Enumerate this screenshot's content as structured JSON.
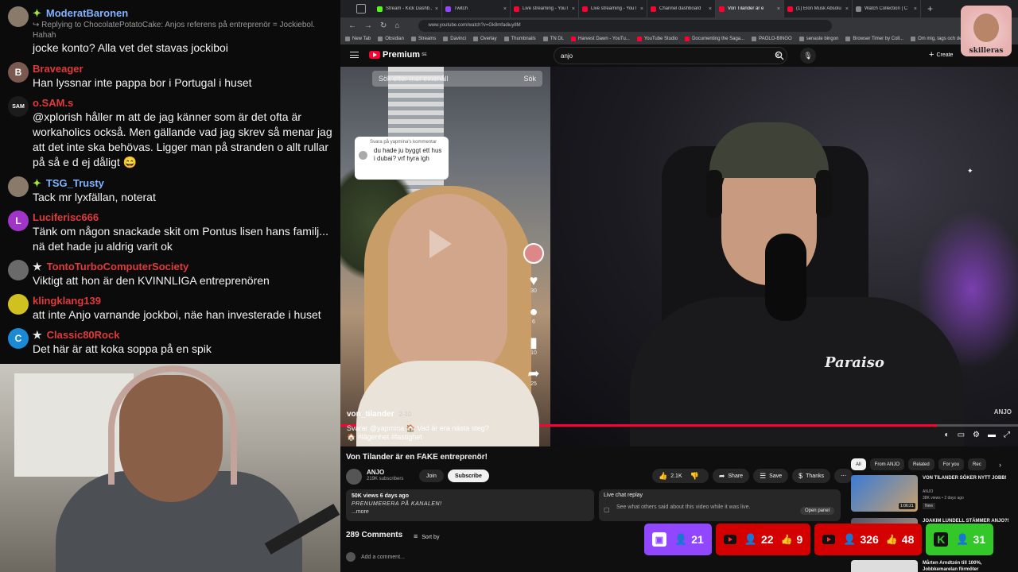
{
  "chat": {
    "messages": [
      {
        "user": "ModeratBaronen",
        "badge": "✦",
        "name_color": "#7fb2ff",
        "avatar_color": "#8a7a6a",
        "avatar_letter": "",
        "reply": "↪ Replying to ChocolatePotatoCake: Anjos referens på entreprenör = Jockiebol. Hahah",
        "text": "jocke konto? Alla vet det stavas jockiboi"
      },
      {
        "user": "Braveager",
        "badge": "",
        "name_color": "#e03a3a",
        "avatar_color": "#7a5a50",
        "avatar_letter": "B",
        "reply": "",
        "text": "Han lyssnar inte pappa bor i Portugal i huset"
      },
      {
        "user": "o.SAM.s",
        "badge": "",
        "name_color": "#e03a3a",
        "avatar_color": "#1c1c1c",
        "avatar_letter": "SAM",
        "reply": "",
        "text": "@xplorish håller m att de jag känner som är det ofta är workaholics också. Men gällande vad jag skrev så menar jag att det inte ska behövas. Ligger man på stranden o allt rullar på så e d ej dåligt 😄"
      },
      {
        "user": "TSG_Trusty",
        "badge": "✦",
        "name_color": "#7fb2ff",
        "avatar_color": "#8a7a6a",
        "avatar_letter": "",
        "reply": "",
        "text": "Tack mr lyxfällan, noterat"
      },
      {
        "user": "Luciferisc666",
        "badge": "",
        "name_color": "#e03a3a",
        "avatar_color": "#a035c8",
        "avatar_letter": "L",
        "reply": "",
        "text": "Tänk om någon snackade skit om Pontus lisen hans familj... nä det hade ju aldrig varit ok"
      },
      {
        "user": "TontoTurboComputerSociety",
        "badge": "★",
        "name_color": "#e03a3a",
        "avatar_color": "#6a6a6a",
        "avatar_letter": "",
        "reply": "",
        "text": "Viktigt att hon är den KVINNLIGA entreprenören"
      },
      {
        "user": "klingklang139",
        "badge": "",
        "name_color": "#e03a3a",
        "avatar_color": "#d0c020",
        "avatar_letter": "",
        "reply": "",
        "text": "att inte Anjo varnande jockboi, näe han investerade i huset"
      },
      {
        "user": "Classic80Rock",
        "badge": "★",
        "name_color": "#e03a3a",
        "avatar_color": "#1a8ad4",
        "avatar_letter": "C",
        "reply": "",
        "text": "Det här är att koka soppa på en spik"
      }
    ]
  },
  "browser": {
    "tabs": [
      {
        "title": "Stream - Kick Dashb...",
        "color": "#53fc18",
        "active": false
      },
      {
        "title": "Twitch",
        "color": "#9146ff",
        "active": false
      },
      {
        "title": "Live streaming - YouT",
        "color": "#ff0033",
        "active": false
      },
      {
        "title": "Live streaming - YouT",
        "color": "#ff0033",
        "active": false
      },
      {
        "title": "Channel dashboard",
        "color": "#ff0033",
        "active": false
      },
      {
        "title": "Von Tilander är e",
        "color": "#ff0033",
        "active": true
      },
      {
        "title": "(1) Elon Musk Absolu",
        "color": "#ff0033",
        "active": false
      },
      {
        "title": "Watch Collection | C",
        "color": "#888888",
        "active": false
      }
    ],
    "url": "www.youtube.com/watch?v=Gk8mfadiuy8M",
    "bookmarks": [
      "New Tab",
      "Obsidian",
      "Streams",
      "Davinci",
      "Overlay",
      "Thumbnails",
      "TN DL",
      "Harvest Dawn - YouTu...",
      "YouTube Studio",
      "Documenting the Saga...",
      "PAOLO-BINGO",
      "senaste bingon",
      "Browser Timer by Coll...",
      "Om mig, tags och des..."
    ]
  },
  "youtube": {
    "logo_text": "Premium",
    "logo_sup": "SE",
    "search_value": "anjo",
    "create_label": "Create",
    "tiktok": {
      "search_placeholder": "Sök efter mer innehåll",
      "search_button": "Sök",
      "bubble_meta": "Svara på yapmina's kommentar",
      "bubble_text": "du hade ju byggt ett hus i dubai? vrf hyra lgh",
      "likes": "30",
      "comments": "6",
      "saves": "10",
      "shares": "25",
      "username": "von_tilander",
      "date": "2-10",
      "caption": "Svarar @yapmina 🏠 Vad är era nästa steg? 🏠 #lägenhet #fastighet"
    },
    "studio_logo": "Paraiso",
    "studio_watermark": "ANJO",
    "progress_fraction": 0.88,
    "video_title": "Von Tilander är en FAKE entreprenör!",
    "channel_name": "ANJO",
    "subscribers": "219K subscribers",
    "join_label": "Join",
    "subscribe_label": "Subscribe",
    "likes": "2.1K",
    "share_label": "Share",
    "save_label": "Save",
    "thanks_label": "Thanks",
    "views_line": "50K views  6 days ago",
    "desc_line": "PRENUMERERA PÅ KANALEN!",
    "more_label": "...more",
    "live_replay_title": "Live chat replay",
    "live_replay_text": "See what others said about this video while it was live.",
    "open_panel": "Open panel",
    "comments_count": "289 Comments",
    "sort_by": "Sort by",
    "add_comment": "Add a comment...",
    "chips": [
      "All",
      "From ANJO",
      "Related",
      "For you",
      "Rec"
    ],
    "recommendations": [
      {
        "title": "VON TILANDER SÖKER NYTT JOBB!",
        "channel": "ANJO",
        "meta": "38K views • 2 days ago",
        "duration": "1:06:21",
        "new": "New"
      },
      {
        "title": "JOAKIM LUNDELL STÄMMER ANJO?!",
        "channel": "ANJO",
        "meta": "",
        "duration": "",
        "new": ""
      },
      {
        "title": "Mårten Arndtzén till 100%, Jobbkemarelan förmöter",
        "channel": "",
        "meta": "",
        "duration": "",
        "new": ""
      }
    ]
  },
  "overlay": {
    "mascot_label": "skilleras",
    "viewers": [
      {
        "platform": "twitch",
        "count": "21",
        "likes": ""
      },
      {
        "platform": "youtube",
        "count": "22",
        "likes": "9"
      },
      {
        "platform": "youtube",
        "count": "326",
        "likes": "48"
      },
      {
        "platform": "kick",
        "count": "31",
        "likes": ""
      }
    ]
  }
}
